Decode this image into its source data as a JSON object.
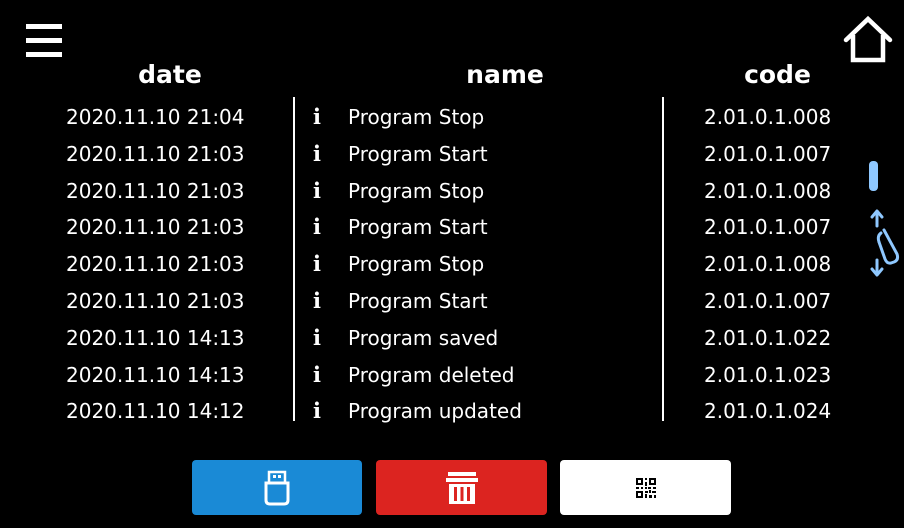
{
  "icons": {
    "menu": "menu-icon",
    "home": "home-icon",
    "info": "info-icon",
    "drag": "drag-scroll-icon",
    "usb": "usb-icon",
    "trash": "trash-icon",
    "qr": "qr-code-icon"
  },
  "colors": {
    "background": "#000000",
    "text": "#ffffff",
    "usb_button": "#1a8ad6",
    "delete_button": "#dc2420",
    "qr_button": "#ffffff",
    "scroll_accent": "#8fc8ff"
  },
  "headers": {
    "date": "date",
    "name": "name",
    "code": "code"
  },
  "rows": [
    {
      "date": "2020.11.10  21:04",
      "info": "i",
      "name": "Program Stop",
      "code": "2.01.0.1.008"
    },
    {
      "date": "2020.11.10  21:03",
      "info": "i",
      "name": "Program Start",
      "code": "2.01.0.1.007"
    },
    {
      "date": "2020.11.10  21:03",
      "info": "i",
      "name": "Program Stop",
      "code": "2.01.0.1.008"
    },
    {
      "date": "2020.11.10  21:03",
      "info": "i",
      "name": "Program Start",
      "code": "2.01.0.1.007"
    },
    {
      "date": "2020.11.10  21:03",
      "info": "i",
      "name": "Program Stop",
      "code": "2.01.0.1.008"
    },
    {
      "date": "2020.11.10  21:03",
      "info": "i",
      "name": "Program Start",
      "code": "2.01.0.1.007"
    },
    {
      "date": "2020.11.10  14:13",
      "info": "i",
      "name": "Program saved",
      "code": "2.01.0.1.022"
    },
    {
      "date": "2020.11.10  14:13",
      "info": "i",
      "name": "Program deleted",
      "code": "2.01.0.1.023"
    },
    {
      "date": "2020.11.10  14:12",
      "info": "i",
      "name": "Program updated",
      "code": "2.01.0.1.024"
    }
  ]
}
